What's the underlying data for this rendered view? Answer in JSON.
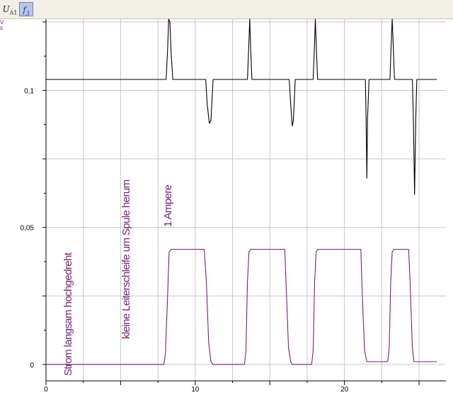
{
  "toolbar": {
    "channel_button": {
      "symbol": "U",
      "subscript": "A1"
    },
    "function_button": {
      "symbol": "f",
      "subscript": "3"
    }
  },
  "y_unit": {
    "top": "V",
    "bottom": "s"
  },
  "chart_data": {
    "type": "line",
    "xlim": [
      0,
      26.8
    ],
    "ylim": [
      -0.006,
      0.126
    ],
    "x_ticks": [
      0,
      10,
      20
    ],
    "x_tick_labels": [
      "0",
      "10",
      "20"
    ],
    "y_ticks": [
      0,
      0.05,
      0.1
    ],
    "y_tick_labels": [
      "0",
      "0,05",
      "0,1"
    ],
    "grid": true,
    "annotations": [
      {
        "text": "Strom langsam hochgedreht",
        "x": 1.7
      },
      {
        "text": "kleine Leiterschleife um Spule herum",
        "x": 5.6
      },
      {
        "text": "1 Ampere",
        "x": 8.4
      }
    ],
    "series": [
      {
        "color": "#000000",
        "x": [
          0,
          8.05,
          8.15,
          8.22,
          8.3,
          8.38,
          8.5,
          8.7,
          10.7,
          10.8,
          10.95,
          11.05,
          11.2,
          11.4,
          13.5,
          13.58,
          13.65,
          13.72,
          13.8,
          14.0,
          16.3,
          16.4,
          16.5,
          16.58,
          16.7,
          16.9,
          17.9,
          17.98,
          18.05,
          18.12,
          18.2,
          18.4,
          21.4,
          21.45,
          21.5,
          21.55,
          21.65,
          21.8,
          23.05,
          23.12,
          23.2,
          23.28,
          23.35,
          23.5,
          24.55,
          24.62,
          24.7,
          24.78,
          24.85,
          25.0,
          26.2
        ],
        "y": [
          0.104,
          0.104,
          0.115,
          0.126,
          0.125,
          0.114,
          0.104,
          0.104,
          0.104,
          0.095,
          0.088,
          0.089,
          0.104,
          0.104,
          0.104,
          0.115,
          0.126,
          0.115,
          0.104,
          0.104,
          0.104,
          0.095,
          0.087,
          0.089,
          0.104,
          0.104,
          0.104,
          0.115,
          0.126,
          0.115,
          0.104,
          0.104,
          0.104,
          0.09,
          0.068,
          0.09,
          0.104,
          0.104,
          0.104,
          0.115,
          0.126,
          0.115,
          0.104,
          0.104,
          0.104,
          0.09,
          0.062,
          0.09,
          0.104,
          0.104,
          0.104
        ]
      },
      {
        "color": "#7a1f7a",
        "x": [
          0,
          7.9,
          8.0,
          8.15,
          8.25,
          8.4,
          10.6,
          10.75,
          10.9,
          11.05,
          11.2,
          13.3,
          13.4,
          13.5,
          13.6,
          13.7,
          16.0,
          16.1,
          16.25,
          16.4,
          16.5,
          17.8,
          17.9,
          18.0,
          18.1,
          18.2,
          21.1,
          21.2,
          21.35,
          21.5,
          21.6,
          22.9,
          23.0,
          23.1,
          23.2,
          23.3,
          24.3,
          24.4,
          24.55,
          24.65,
          24.8,
          26.2
        ],
        "y": [
          0.0,
          0.0,
          0.004,
          0.025,
          0.041,
          0.042,
          0.042,
          0.03,
          0.008,
          0.001,
          0.0,
          0.0,
          0.005,
          0.03,
          0.041,
          0.042,
          0.042,
          0.028,
          0.006,
          0.001,
          0.0,
          0.0,
          0.005,
          0.03,
          0.041,
          0.042,
          0.042,
          0.025,
          0.005,
          0.001,
          0.001,
          0.001,
          0.006,
          0.03,
          0.041,
          0.042,
          0.042,
          0.03,
          0.006,
          0.001,
          0.001,
          0.001
        ]
      }
    ]
  }
}
